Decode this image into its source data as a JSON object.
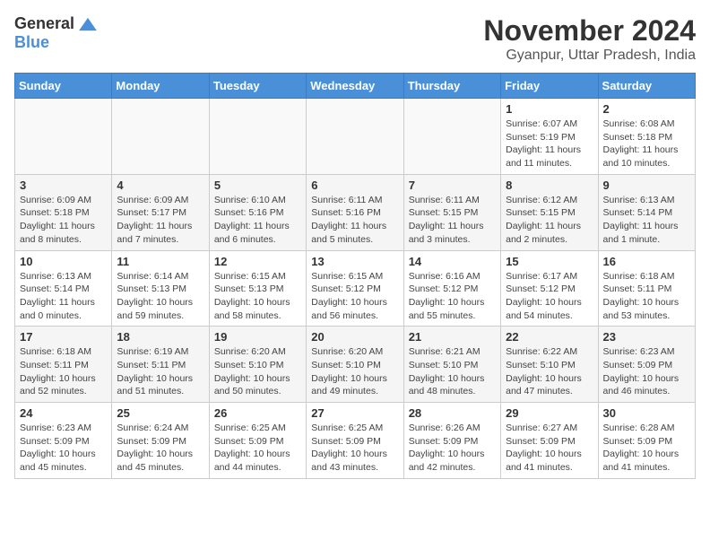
{
  "header": {
    "logo_line1": "General",
    "logo_line2": "Blue",
    "month_title": "November 2024",
    "location": "Gyanpur, Uttar Pradesh, India"
  },
  "weekdays": [
    "Sunday",
    "Monday",
    "Tuesday",
    "Wednesday",
    "Thursday",
    "Friday",
    "Saturday"
  ],
  "weeks": [
    [
      {
        "day": "",
        "info": ""
      },
      {
        "day": "",
        "info": ""
      },
      {
        "day": "",
        "info": ""
      },
      {
        "day": "",
        "info": ""
      },
      {
        "day": "",
        "info": ""
      },
      {
        "day": "1",
        "info": "Sunrise: 6:07 AM\nSunset: 5:19 PM\nDaylight: 11 hours and 11 minutes."
      },
      {
        "day": "2",
        "info": "Sunrise: 6:08 AM\nSunset: 5:18 PM\nDaylight: 11 hours and 10 minutes."
      }
    ],
    [
      {
        "day": "3",
        "info": "Sunrise: 6:09 AM\nSunset: 5:18 PM\nDaylight: 11 hours and 8 minutes."
      },
      {
        "day": "4",
        "info": "Sunrise: 6:09 AM\nSunset: 5:17 PM\nDaylight: 11 hours and 7 minutes."
      },
      {
        "day": "5",
        "info": "Sunrise: 6:10 AM\nSunset: 5:16 PM\nDaylight: 11 hours and 6 minutes."
      },
      {
        "day": "6",
        "info": "Sunrise: 6:11 AM\nSunset: 5:16 PM\nDaylight: 11 hours and 5 minutes."
      },
      {
        "day": "7",
        "info": "Sunrise: 6:11 AM\nSunset: 5:15 PM\nDaylight: 11 hours and 3 minutes."
      },
      {
        "day": "8",
        "info": "Sunrise: 6:12 AM\nSunset: 5:15 PM\nDaylight: 11 hours and 2 minutes."
      },
      {
        "day": "9",
        "info": "Sunrise: 6:13 AM\nSunset: 5:14 PM\nDaylight: 11 hours and 1 minute."
      }
    ],
    [
      {
        "day": "10",
        "info": "Sunrise: 6:13 AM\nSunset: 5:14 PM\nDaylight: 11 hours and 0 minutes."
      },
      {
        "day": "11",
        "info": "Sunrise: 6:14 AM\nSunset: 5:13 PM\nDaylight: 10 hours and 59 minutes."
      },
      {
        "day": "12",
        "info": "Sunrise: 6:15 AM\nSunset: 5:13 PM\nDaylight: 10 hours and 58 minutes."
      },
      {
        "day": "13",
        "info": "Sunrise: 6:15 AM\nSunset: 5:12 PM\nDaylight: 10 hours and 56 minutes."
      },
      {
        "day": "14",
        "info": "Sunrise: 6:16 AM\nSunset: 5:12 PM\nDaylight: 10 hours and 55 minutes."
      },
      {
        "day": "15",
        "info": "Sunrise: 6:17 AM\nSunset: 5:12 PM\nDaylight: 10 hours and 54 minutes."
      },
      {
        "day": "16",
        "info": "Sunrise: 6:18 AM\nSunset: 5:11 PM\nDaylight: 10 hours and 53 minutes."
      }
    ],
    [
      {
        "day": "17",
        "info": "Sunrise: 6:18 AM\nSunset: 5:11 PM\nDaylight: 10 hours and 52 minutes."
      },
      {
        "day": "18",
        "info": "Sunrise: 6:19 AM\nSunset: 5:11 PM\nDaylight: 10 hours and 51 minutes."
      },
      {
        "day": "19",
        "info": "Sunrise: 6:20 AM\nSunset: 5:10 PM\nDaylight: 10 hours and 50 minutes."
      },
      {
        "day": "20",
        "info": "Sunrise: 6:20 AM\nSunset: 5:10 PM\nDaylight: 10 hours and 49 minutes."
      },
      {
        "day": "21",
        "info": "Sunrise: 6:21 AM\nSunset: 5:10 PM\nDaylight: 10 hours and 48 minutes."
      },
      {
        "day": "22",
        "info": "Sunrise: 6:22 AM\nSunset: 5:10 PM\nDaylight: 10 hours and 47 minutes."
      },
      {
        "day": "23",
        "info": "Sunrise: 6:23 AM\nSunset: 5:09 PM\nDaylight: 10 hours and 46 minutes."
      }
    ],
    [
      {
        "day": "24",
        "info": "Sunrise: 6:23 AM\nSunset: 5:09 PM\nDaylight: 10 hours and 45 minutes."
      },
      {
        "day": "25",
        "info": "Sunrise: 6:24 AM\nSunset: 5:09 PM\nDaylight: 10 hours and 45 minutes."
      },
      {
        "day": "26",
        "info": "Sunrise: 6:25 AM\nSunset: 5:09 PM\nDaylight: 10 hours and 44 minutes."
      },
      {
        "day": "27",
        "info": "Sunrise: 6:25 AM\nSunset: 5:09 PM\nDaylight: 10 hours and 43 minutes."
      },
      {
        "day": "28",
        "info": "Sunrise: 6:26 AM\nSunset: 5:09 PM\nDaylight: 10 hours and 42 minutes."
      },
      {
        "day": "29",
        "info": "Sunrise: 6:27 AM\nSunset: 5:09 PM\nDaylight: 10 hours and 41 minutes."
      },
      {
        "day": "30",
        "info": "Sunrise: 6:28 AM\nSunset: 5:09 PM\nDaylight: 10 hours and 41 minutes."
      }
    ]
  ]
}
